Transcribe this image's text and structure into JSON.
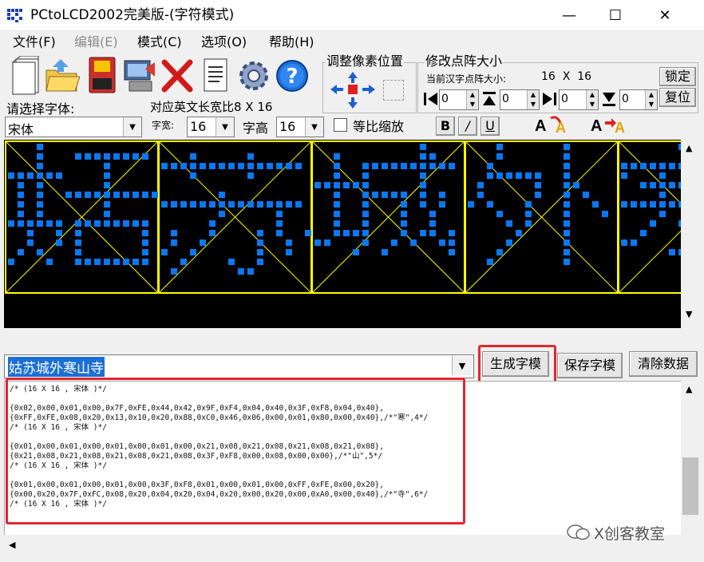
{
  "window": {
    "title": "PCtoLCD2002完美版-(字符模式)",
    "controls": [
      "—",
      "☐",
      "✕"
    ]
  },
  "menu": {
    "items": [
      {
        "label": "文件(F)",
        "enabled": true
      },
      {
        "label": "编辑(E)",
        "enabled": false
      },
      {
        "label": "模式(C)",
        "enabled": true
      },
      {
        "label": "选项(O)",
        "enabled": true
      },
      {
        "label": "帮助(H)",
        "enabled": true
      }
    ]
  },
  "toolbar": {
    "icons": [
      "new-file-icon",
      "open-folder-icon",
      "save-disk-icon",
      "settings-computer-icon",
      "delete-x-icon",
      "document-icon",
      "gear-icon",
      "help-icon"
    ]
  },
  "font_panel": {
    "label": "请选择字体:",
    "font_value": "宋体",
    "ratio_label": "对应英文长宽比8 X 16",
    "width_label": "字宽:",
    "width_value": "16",
    "height_label": "字高",
    "height_value": "16",
    "proportional_label": "等比缩放",
    "bold": "B",
    "italic": "/",
    "underline": "U"
  },
  "pixel_adjust": {
    "label": "调整像素位置"
  },
  "matrix": {
    "label": "修改点阵大小",
    "current_label": "当前汉字点阵大小:",
    "current_value": "16  X  16",
    "lock": "锁定",
    "reset": "复位",
    "spins": [
      "0",
      "0",
      "0",
      "0"
    ]
  },
  "preview": {
    "accent_dot": "#0a78f0",
    "grid_color": "#ffff00",
    "cells": 5
  },
  "input": {
    "value": "姑苏城外寒山寺"
  },
  "buttons": {
    "generate": "生成字模",
    "save": "保存字模",
    "clear": "清除数据"
  },
  "output": {
    "lines": [
      "/* (16 X 16 , 宋体 )*/",
      "",
      "{0x02,0x00,0x01,0x00,0x7F,0xFE,0x44,0x42,0x9F,0xF4,0x04,0x40,0x3F,0xF8,0x04,0x40},",
      "{0xFF,0xFE,0x08,0x20,0x13,0x10,0x20,0x88,0xC0,0x46,0x06,0x00,0x01,0x80,0x00,0x40},/*\"寒\",4*/",
      "/* (16 X 16 , 宋体 )*/",
      "",
      "{0x01,0x00,0x01,0x00,0x01,0x00,0x01,0x00,0x21,0x08,0x21,0x08,0x21,0x08,0x21,0x08},",
      "{0x21,0x08,0x21,0x08,0x21,0x08,0x21,0x08,0x3F,0xF8,0x00,0x08,0x00,0x00},/*\"山\",5*/",
      "/* (16 X 16 , 宋体 )*/",
      "",
      "{0x01,0x00,0x01,0x00,0x01,0x00,0x3F,0xF8,0x01,0x00,0x01,0x00,0xFF,0xFE,0x00,0x20},",
      "{0x00,0x20,0x7F,0xFC,0x08,0x20,0x04,0x20,0x04,0x20,0x00,0x20,0x00,0xA0,0x00,0x40},/*\"寺\",6*/",
      "/* (16 X 16 , 宋体 )*/"
    ]
  },
  "watermark": {
    "text": "X创客教室"
  }
}
